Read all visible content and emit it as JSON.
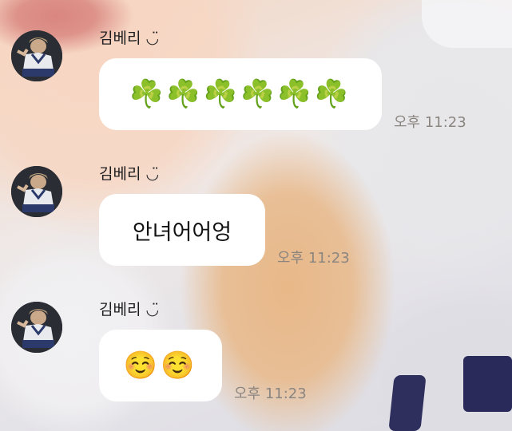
{
  "messages": [
    {
      "sender": "김베리 ◡̈",
      "text": "☘️☘️☘️☘️☘️☘️",
      "time": "오후 11:23",
      "kind": "emoji"
    },
    {
      "sender": "김베리 ◡̈",
      "text": "안녀어어엉",
      "time": "오후 11:23",
      "kind": "text"
    },
    {
      "sender": "김베리 ◡̈",
      "text": "☺️☺️",
      "time": "오후 11:23",
      "kind": "emoji"
    }
  ],
  "icons": {
    "avatar": "profile-photo"
  }
}
